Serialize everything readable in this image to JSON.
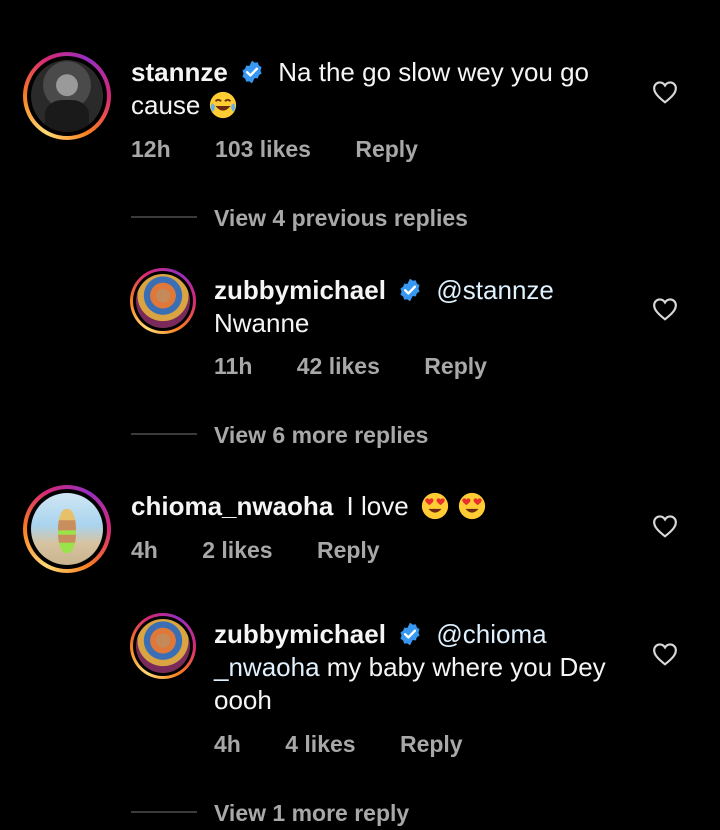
{
  "comments": [
    {
      "username": "stannze",
      "verified": true,
      "text_line1": "Na the go slow wey you go",
      "text_line2": "cause",
      "emoji": "face-with-tears-of-joy",
      "time": "12h",
      "likes": "103 likes",
      "reply_label": "Reply",
      "view_previous": "View 4 previous replies",
      "reply": {
        "username": "zubbymichael",
        "verified": true,
        "mention": "@stannze",
        "text": "Nwanne",
        "time": "11h",
        "likes": "42 likes",
        "reply_label": "Reply"
      },
      "view_more": "View 6 more replies"
    },
    {
      "username": "chioma_nwaoha",
      "verified": false,
      "text": "I love",
      "emojis": [
        "smiling-face-with-heart-eyes",
        "smiling-face-with-heart-eyes"
      ],
      "time": "4h",
      "likes": "2 likes",
      "reply_label": "Reply",
      "reply": {
        "username": "zubbymichael",
        "verified": true,
        "mention_line1": "@chioma",
        "mention_line2": "_nwaoha",
        "text_line2": " my baby where you Dey",
        "text_line3": "oooh",
        "time": "4h",
        "likes": "4 likes",
        "reply_label": "Reply"
      },
      "view_more": "View 1 more reply"
    }
  ],
  "icons": {
    "like": "heart-outline-icon",
    "verified": "verified-badge-icon"
  },
  "colors": {
    "background": "#000000",
    "text": "#f5f5f5",
    "secondary": "#a8a8a8",
    "verified": "#3897f0",
    "mention": "#e0f1ff"
  }
}
